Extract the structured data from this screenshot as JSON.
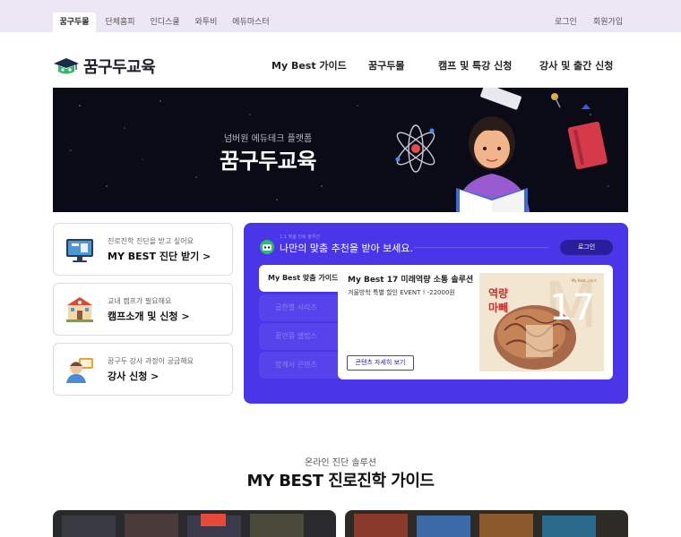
{
  "topbar": {
    "tabs": [
      "꿈구두몰",
      "단체홈피",
      "인디스쿨",
      "와투비",
      "에듀마스터"
    ],
    "active_tab": "꿈구두몰",
    "login": "로그인",
    "signup": "회원가입"
  },
  "header": {
    "logo_text": "꿈구두교육",
    "nav": [
      "My Best 가이드",
      "꿈구두몰",
      "캠프 및 특강 신청",
      "강사 및 출간 신청"
    ]
  },
  "hero": {
    "subtitle": "넘버원 에듀테크 플랫폼",
    "title": "꿈구두교육"
  },
  "cards": [
    {
      "sub": "진로진학 진단을 받고 싶어요",
      "title": "MY BEST 진단 받기 >",
      "icon": "computer-icon"
    },
    {
      "sub": "교내 캠프가 필요해요",
      "title": "캠프소개 및 신청 >",
      "icon": "school-icon"
    },
    {
      "sub": "꿈구두 강사 과정이 궁금해요",
      "title": "강사 신청 >",
      "icon": "teacher-icon"
    }
  ],
  "panel": {
    "small_label": "1:1 맞춤 진로 솔루션",
    "headline": "나만의 맞춤 추천을 받아 보세요.",
    "login_button": "로그인",
    "tabs": [
      "My Best 맞춤 가이드",
      "글한별 시리즈",
      "꿈만쯤 앨범스",
      "함께서 콘텐츠"
    ],
    "active_tab_index": 0,
    "content": {
      "title": "My Best 17 미래역량 소통 솔루션",
      "subtitle": "겨울방학 특별 할인 EVENT ! -22000원",
      "button": "콘텐츠 자세히 보기",
      "book_title_1": "역량",
      "book_title_2": "마빼",
      "book_number": "17",
      "book_series": "My Best 시리즈"
    }
  },
  "section": {
    "subtitle": "온라인 진단 솔루션",
    "title": "MY BEST 진로진학 가이드"
  },
  "colors": {
    "accent": "#4a36e8",
    "topbar_bg": "#ebe7f4",
    "hero_bg": "#0a0b16"
  }
}
